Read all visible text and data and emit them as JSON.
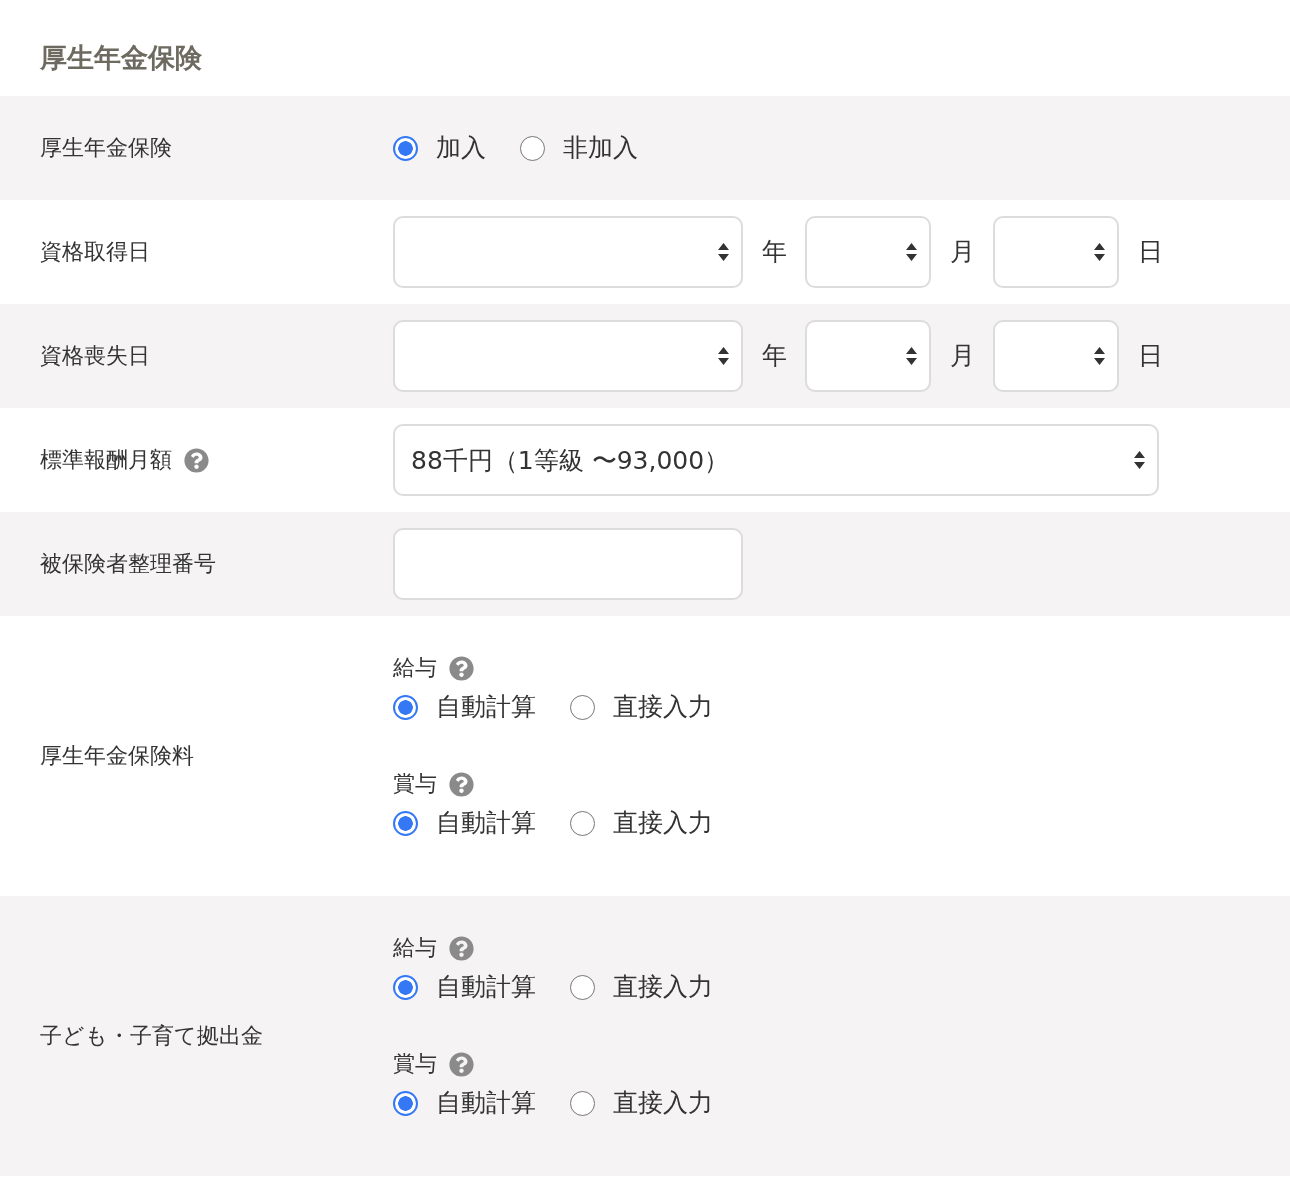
{
  "section_title": "厚生年金保険",
  "rows": [
    {
      "kind": "radio",
      "label": "厚生年金保険",
      "options": [
        {
          "label": "加入",
          "selected": true
        },
        {
          "label": "非加入",
          "selected": false
        }
      ]
    },
    {
      "kind": "date",
      "label": "資格取得日",
      "fields": [
        {
          "unit": "年"
        },
        {
          "unit": "月"
        },
        {
          "unit": "日"
        }
      ]
    },
    {
      "kind": "date",
      "label": "資格喪失日",
      "fields": [
        {
          "unit": "年"
        },
        {
          "unit": "月"
        },
        {
          "unit": "日"
        }
      ]
    },
    {
      "kind": "select",
      "label": "標準報酬月額",
      "help": true,
      "value": "88千円（1等級 〜93,000）"
    },
    {
      "kind": "input",
      "label": "被保険者整理番号"
    },
    {
      "kind": "radio_groups",
      "label": "厚生年金保険料",
      "groups": [
        {
          "title": "給与",
          "help": true,
          "options": [
            {
              "label": "自動計算",
              "selected": true
            },
            {
              "label": "直接入力",
              "selected": false
            }
          ]
        },
        {
          "title": "賞与",
          "help": true,
          "options": [
            {
              "label": "自動計算",
              "selected": true
            },
            {
              "label": "直接入力",
              "selected": false
            }
          ]
        }
      ]
    },
    {
      "kind": "radio_groups",
      "label": "子ども・子育て拠出金",
      "groups": [
        {
          "title": "給与",
          "help": true,
          "options": [
            {
              "label": "自動計算",
              "selected": true
            },
            {
              "label": "直接入力",
              "selected": false
            }
          ]
        },
        {
          "title": "賞与",
          "help": true,
          "options": [
            {
              "label": "自動計算",
              "selected": true
            },
            {
              "label": "直接入力",
              "selected": false
            }
          ]
        }
      ]
    }
  ]
}
